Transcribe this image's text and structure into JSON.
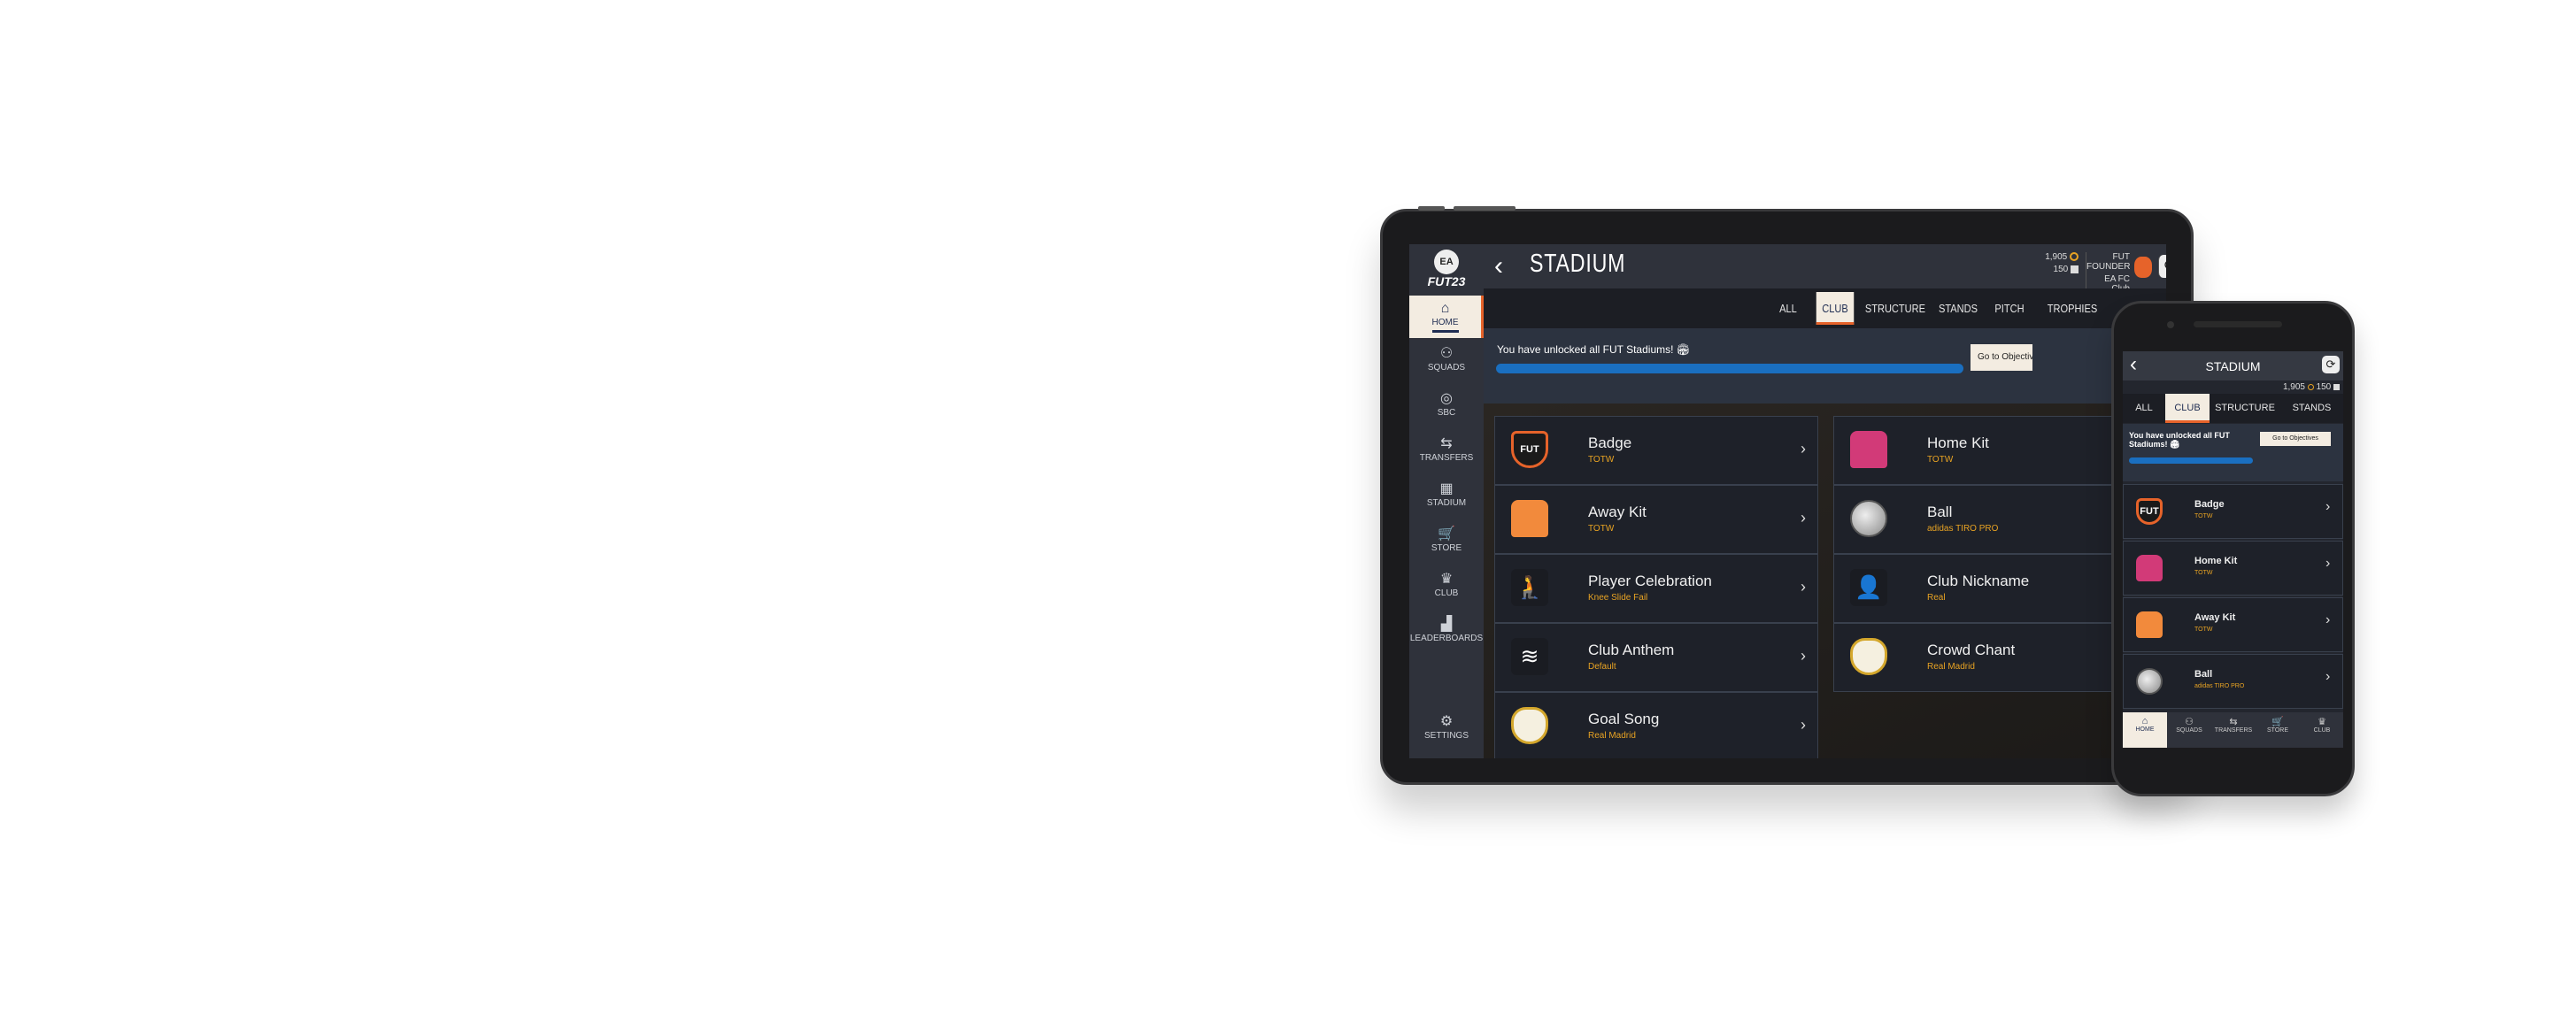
{
  "tablet": {
    "app_logo": "FUT23",
    "logo_text": "EA",
    "title": "STADIUM",
    "coins": "1,905",
    "points": "150",
    "club_label": "FUT FOUNDER",
    "club_name": "EA FC Club",
    "sidebar": [
      {
        "label": "HOME",
        "icon": "home-icon",
        "glyph": "⌂",
        "active": true
      },
      {
        "label": "SQUADS",
        "icon": "squads-icon",
        "glyph": "⚇"
      },
      {
        "label": "SBC",
        "icon": "sbc-icon",
        "glyph": "◎"
      },
      {
        "label": "TRANSFERS",
        "icon": "transfers-icon",
        "glyph": "⇆"
      },
      {
        "label": "STADIUM",
        "icon": "stadium-icon",
        "glyph": "▦"
      },
      {
        "label": "STORE",
        "icon": "cart-icon",
        "glyph": "🛒"
      },
      {
        "label": "CLUB",
        "icon": "club-icon",
        "glyph": "♛"
      },
      {
        "label": "LEADERBOARDS",
        "icon": "leaderboards-icon",
        "glyph": "▟"
      }
    ],
    "settings": {
      "label": "SETTINGS",
      "icon": "gear-icon",
      "glyph": "⚙"
    },
    "tabs": [
      "ALL",
      "CLUB",
      "STRUCTURE",
      "STANDS",
      "PITCH",
      "TROPHIES"
    ],
    "active_tab": "CLUB",
    "banner": {
      "text": "You have unlocked all FUT Stadiums! 🏟",
      "progress": 100,
      "button": "Go to Objectives"
    },
    "items": [
      {
        "title": "Badge",
        "sub": "TOTW",
        "icon": "badge-icon",
        "kind": "shield"
      },
      {
        "title": "Home Kit",
        "sub": "TOTW",
        "icon": "home-kit-icon",
        "kind": "shirt",
        "color": "#d23a78"
      },
      {
        "title": "Away Kit",
        "sub": "TOTW",
        "icon": "away-kit-icon",
        "kind": "shirt",
        "color": "#f28a3c"
      },
      {
        "title": "Ball",
        "sub": "adidas TIRO PRO",
        "icon": "ball-icon",
        "kind": "ball"
      },
      {
        "title": "Player Celebration",
        "sub": "Knee Slide Fail",
        "icon": "celebration-icon",
        "kind": "glyph",
        "glyph": "🧎"
      },
      {
        "title": "Club Nickname",
        "sub": "Real",
        "icon": "nickname-icon",
        "kind": "glyph",
        "glyph": "👤"
      },
      {
        "title": "Club Anthem",
        "sub": "Default",
        "icon": "anthem-icon",
        "kind": "glyph",
        "glyph": "≋"
      },
      {
        "title": "Crowd Chant",
        "sub": "Real Madrid",
        "icon": "crest-icon",
        "kind": "crest"
      },
      {
        "title": "Goal Song",
        "sub": "Real Madrid",
        "icon": "crest-icon",
        "kind": "crest"
      }
    ]
  },
  "phone": {
    "title": "STADIUM",
    "coins": "1,905",
    "points": "150",
    "tabs": [
      "ALL",
      "CLUB",
      "STRUCTURE",
      "STANDS"
    ],
    "banner": {
      "text": "You have unlocked all FUT Stadiums! 🏟",
      "progress": 100,
      "button": "Go to Objectives"
    },
    "items": [
      {
        "title": "Badge",
        "sub": "TOTW",
        "kind": "shield",
        "icon": "badge-icon"
      },
      {
        "title": "Home Kit",
        "sub": "TOTW",
        "kind": "shirt",
        "color": "#d23a78",
        "icon": "home-kit-icon"
      },
      {
        "title": "Away Kit",
        "sub": "TOTW",
        "kind": "shirt",
        "color": "#f28a3c",
        "icon": "away-kit-icon"
      },
      {
        "title": "Ball",
        "sub": "adidas TIRO PRO",
        "kind": "ball",
        "icon": "ball-icon"
      }
    ],
    "nav": [
      {
        "label": "HOME",
        "glyph": "⌂",
        "icon": "home-icon",
        "active": true
      },
      {
        "label": "SQUADS",
        "glyph": "⚇",
        "icon": "squads-icon"
      },
      {
        "label": "TRANSFERS",
        "glyph": "⇆",
        "icon": "transfers-icon"
      },
      {
        "label": "STORE",
        "glyph": "🛒",
        "icon": "cart-icon"
      },
      {
        "label": "CLUB",
        "glyph": "♛",
        "icon": "club-icon"
      }
    ]
  },
  "colors": {
    "accent": "#e6632a",
    "highlight": "#f3ece1",
    "progress": "#1a6fc0",
    "subtitle": "#e8a323"
  }
}
